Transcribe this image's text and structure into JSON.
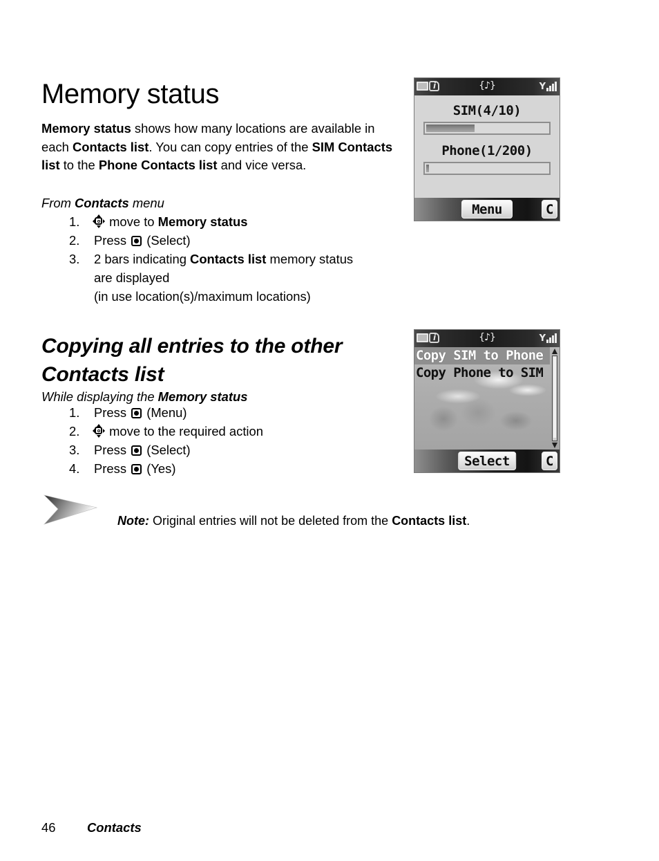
{
  "page": {
    "title": "Memory status",
    "footer_page_number": "46",
    "footer_section": "Contacts"
  },
  "intro": {
    "p1_a": "Memory status",
    "p1_b": " shows how many locations are available in each ",
    "p1_c": "Contacts list",
    "p1_d": ". You can copy entries of the ",
    "p1_e": "SIM Contacts list",
    "p1_f": " to the ",
    "p1_g": "Phone Contacts list",
    "p1_h": " and vice versa.",
    "context_pre": "From ",
    "context_bold": "Contacts",
    "context_post": " menu"
  },
  "steps_memory_status": [
    {
      "number": "1.",
      "icon": "nav-key-icon",
      "text_pre": " move to ",
      "text_bold": "Memory status",
      "text_post": ""
    },
    {
      "number": "2.",
      "icon": "select-key-icon",
      "text_pre": "Press ",
      "text_bold": "",
      "text_post": " (Select)"
    },
    {
      "number": "3.",
      "icon": "",
      "text_pre": "2 bars indicating ",
      "text_bold": "Contacts list",
      "text_post": " memory status",
      "continuation": [
        "are displayed",
        "(in use location(s)/maximum locations)"
      ]
    }
  ],
  "section": {
    "heading": "Copying all entries to the other Contacts list",
    "context_pre": "While displaying the ",
    "context_bold": "Memory status",
    "context_post": ""
  },
  "steps_copying": [
    {
      "number": "1.",
      "icon": "select-key-icon",
      "text_pre": "Press ",
      "text_post": " (Menu)"
    },
    {
      "number": "2.",
      "icon": "nav-key-icon",
      "text_pre": " move to the required action",
      "text_post": ""
    },
    {
      "number": "3.",
      "icon": "select-key-icon",
      "text_pre": "Press ",
      "text_post": " (Select)"
    },
    {
      "number": "4.",
      "icon": "select-key-icon",
      "text_pre": "Press ",
      "text_post": " (Yes)"
    }
  ],
  "note": {
    "label": "Note:",
    "text_pre": " Original entries will not be deleted from the ",
    "text_bold": "Contacts list",
    "text_post": "."
  },
  "phone_screen_1": {
    "status_icons": [
      "battery-icon",
      "sim-info-icon",
      "melody-icon",
      "signal-icon"
    ],
    "melody_glyph": "{♪}",
    "antenna_glyph": "Y",
    "sim": {
      "label": "SIM(4/10)",
      "used": 4,
      "total": 10,
      "percent": 40
    },
    "phone": {
      "label": "Phone(1/200)",
      "used": 1,
      "total": 200,
      "percent": 2
    },
    "softkey_left": "Menu",
    "softkey_right": "C"
  },
  "phone_screen_2": {
    "status_icons": [
      "battery-icon",
      "sim-info-icon",
      "melody-icon",
      "signal-icon"
    ],
    "melody_glyph": "{♪}",
    "antenna_glyph": "Y",
    "menu_items": [
      {
        "label": "Copy SIM to Phone",
        "selected": true
      },
      {
        "label": "Copy Phone to SIM",
        "selected": false
      }
    ],
    "softkey_left": "Select",
    "softkey_right": "C"
  },
  "colors": {
    "page_background": "#ffffff",
    "text": "#000000",
    "screen_background": "#d6d6d6",
    "status_bar": "#1c1c1c",
    "menu_highlight": "#8f8f8f",
    "bar_fill": "#8a8a8a"
  }
}
